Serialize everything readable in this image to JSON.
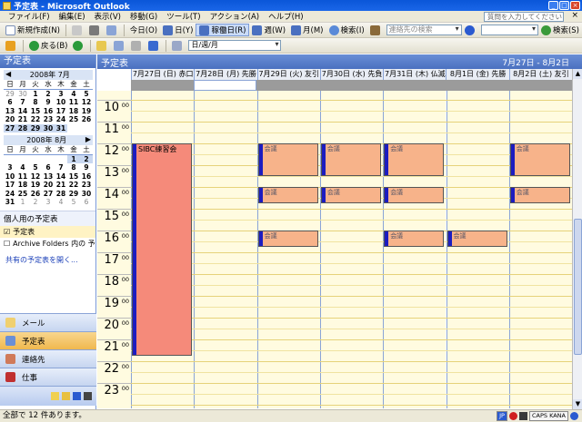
{
  "window": {
    "title": "予定表 - Microsoft Outlook",
    "minimize": "_",
    "maximize": "□",
    "close": "×"
  },
  "menubar": {
    "items": [
      "ファイル(F)",
      "編集(E)",
      "表示(V)",
      "移動(G)",
      "ツール(T)",
      "アクション(A)",
      "ヘルプ(H)"
    ],
    "help_placeholder": "質問を入力してください",
    "close": "×"
  },
  "toolbar1": {
    "new_label": "新規作成(N)",
    "today_label": "今日(O)",
    "day_label": "日(Y)",
    "workweek_label": "稼働日(R)",
    "week_label": "週(W)",
    "month_label": "月(M)",
    "search_label": "検索(I)",
    "contact_placeholder": "連絡先の検索",
    "search2_label": "検索(S)"
  },
  "toolbar2": {
    "back_label": "戻る(B)",
    "view_value": "日/週/月"
  },
  "navpane": {
    "header": "予定表",
    "cal1": {
      "title": "2008年 7月",
      "dow": [
        "日",
        "月",
        "火",
        "水",
        "木",
        "金",
        "土"
      ],
      "days": [
        "29",
        "30",
        "1",
        "2",
        "3",
        "4",
        "5",
        "6",
        "7",
        "8",
        "9",
        "10",
        "11",
        "12",
        "13",
        "14",
        "15",
        "16",
        "17",
        "18",
        "19",
        "20",
        "21",
        "22",
        "23",
        "24",
        "25",
        "26",
        "27",
        "28",
        "29",
        "30",
        "31",
        "",
        ""
      ]
    },
    "cal2": {
      "title": "2008年 8月",
      "dow": [
        "日",
        "月",
        "火",
        "水",
        "木",
        "金",
        "土"
      ],
      "days": [
        "",
        "",
        "",
        "",
        "",
        "1",
        "2",
        "3",
        "4",
        "5",
        "6",
        "7",
        "8",
        "9",
        "10",
        "11",
        "12",
        "13",
        "14",
        "15",
        "16",
        "17",
        "18",
        "19",
        "20",
        "21",
        "22",
        "23",
        "24",
        "25",
        "26",
        "27",
        "28",
        "29",
        "30",
        "31",
        "1",
        "2",
        "3",
        "4",
        "5",
        "6"
      ]
    },
    "my_calendars_title": "個人用の予定表",
    "calendars": [
      {
        "label": "予定表",
        "checked": "☑"
      },
      {
        "label": "Archive Folders 内の 予定表",
        "checked": "☐"
      }
    ],
    "share_link": "共有の予定表を開く...",
    "nav_buttons": [
      {
        "label": "メール"
      },
      {
        "label": "予定表"
      },
      {
        "label": "連絡先"
      },
      {
        "label": "仕事"
      }
    ]
  },
  "calendar": {
    "header": "予定表",
    "range": "7月27日 - 8月2日",
    "days": [
      "7月27日 (日) 赤口",
      "7月28日 (月) 先勝",
      "7月29日 (火) 友引",
      "7月30日 (水) 先負",
      "7月31日 (木) 仏滅",
      "8月1日 (金) 先勝",
      "8月2日 (土) 友引"
    ],
    "hours": [
      "10",
      "11",
      "12",
      "13",
      "14",
      "15",
      "16",
      "17",
      "18",
      "19",
      "20",
      "21",
      "22",
      "23"
    ],
    "minutes": "00",
    "appointments": [
      {
        "day": 0,
        "start": 12.0,
        "end": 21.75,
        "label": "SIBC練習会",
        "color": "red"
      },
      {
        "day": 2,
        "start": 12.0,
        "end": 13.5,
        "label": "会議",
        "color": "orange"
      },
      {
        "day": 2,
        "start": 14.0,
        "end": 14.75,
        "label": "会議",
        "color": "orange"
      },
      {
        "day": 2,
        "start": 16.0,
        "end": 16.75,
        "label": "会議",
        "color": "orange"
      },
      {
        "day": 3,
        "start": 12.0,
        "end": 13.5,
        "label": "会議",
        "color": "orange"
      },
      {
        "day": 3,
        "start": 14.0,
        "end": 14.75,
        "label": "会議",
        "color": "orange"
      },
      {
        "day": 4,
        "start": 12.0,
        "end": 13.5,
        "label": "会議",
        "color": "orange"
      },
      {
        "day": 4,
        "start": 14.0,
        "end": 14.75,
        "label": "会議",
        "color": "orange"
      },
      {
        "day": 4,
        "start": 16.0,
        "end": 16.75,
        "label": "会議",
        "color": "orange"
      },
      {
        "day": 5,
        "start": 16.0,
        "end": 16.75,
        "label": "会議",
        "color": "orange"
      },
      {
        "day": 6,
        "start": 12.0,
        "end": 13.5,
        "label": "会議",
        "color": "orange"
      },
      {
        "day": 6,
        "start": 14.0,
        "end": 14.75,
        "label": "会議",
        "color": "orange"
      }
    ]
  },
  "statusbar": {
    "text": "全部で 12 件あります。",
    "tray": [
      "JP",
      "CAPS KANA"
    ]
  },
  "colors": {
    "appt_orange": "#f7b38a",
    "appt_red": "#f58a7a",
    "grid_bg": "#fffbe0",
    "header_blue": "#4a70c0"
  }
}
